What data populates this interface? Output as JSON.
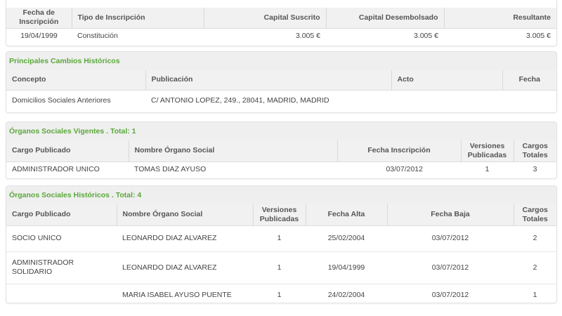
{
  "capital": {
    "headers": [
      "Fecha de Inscripción",
      "Tipo de Inscripción",
      "Capital Suscrito",
      "Capital Desembolsado",
      "Resultante"
    ],
    "rows": [
      [
        "19/04/1999",
        "Constitución",
        "3.005 €",
        "3.005 €",
        "3.005 €"
      ]
    ]
  },
  "cambios": {
    "title": "Principales Cambios Históricos",
    "headers": [
      "Concepto",
      "Publicación",
      "Acto",
      "Fecha"
    ],
    "rows": [
      [
        "Domicilios Sociales Anteriores",
        "C/ ANTONIO LOPEZ, 249., 28041, MADRID, MADRID",
        "",
        ""
      ]
    ]
  },
  "vigentes": {
    "title": "Órganos Sociales Vigentes . Total: 1",
    "headers": [
      "Cargo Publicado",
      "Nombre Órgano Social",
      "Fecha Inscripción",
      "Versiones Publicadas",
      "Cargos Totales"
    ],
    "rows": [
      [
        "ADMINISTRADOR UNICO",
        "TOMAS DIAZ AYUSO",
        "03/07/2012",
        "1",
        "3"
      ]
    ]
  },
  "historicos": {
    "title": "Órganos Sociales Históricos . Total: 4",
    "headers": [
      "Cargo Publicado",
      "Nombre Órgano Social",
      "Versiones Publicadas",
      "Fecha Alta",
      "Fecha Baja",
      "Cargos Totales"
    ],
    "rows": [
      [
        "SOCIO UNICO",
        "LEONARDO DIAZ ALVAREZ",
        "1",
        "25/02/2004",
        "03/07/2012",
        "2"
      ],
      [
        "ADMINISTRADOR SOLIDARIO",
        "LEONARDO DIAZ ALVAREZ",
        "1",
        "19/04/1999",
        "03/07/2012",
        "2"
      ],
      [
        "",
        "MARIA ISABEL AYUSO PUENTE",
        "1",
        "24/02/2004",
        "03/07/2012",
        "1"
      ]
    ]
  }
}
